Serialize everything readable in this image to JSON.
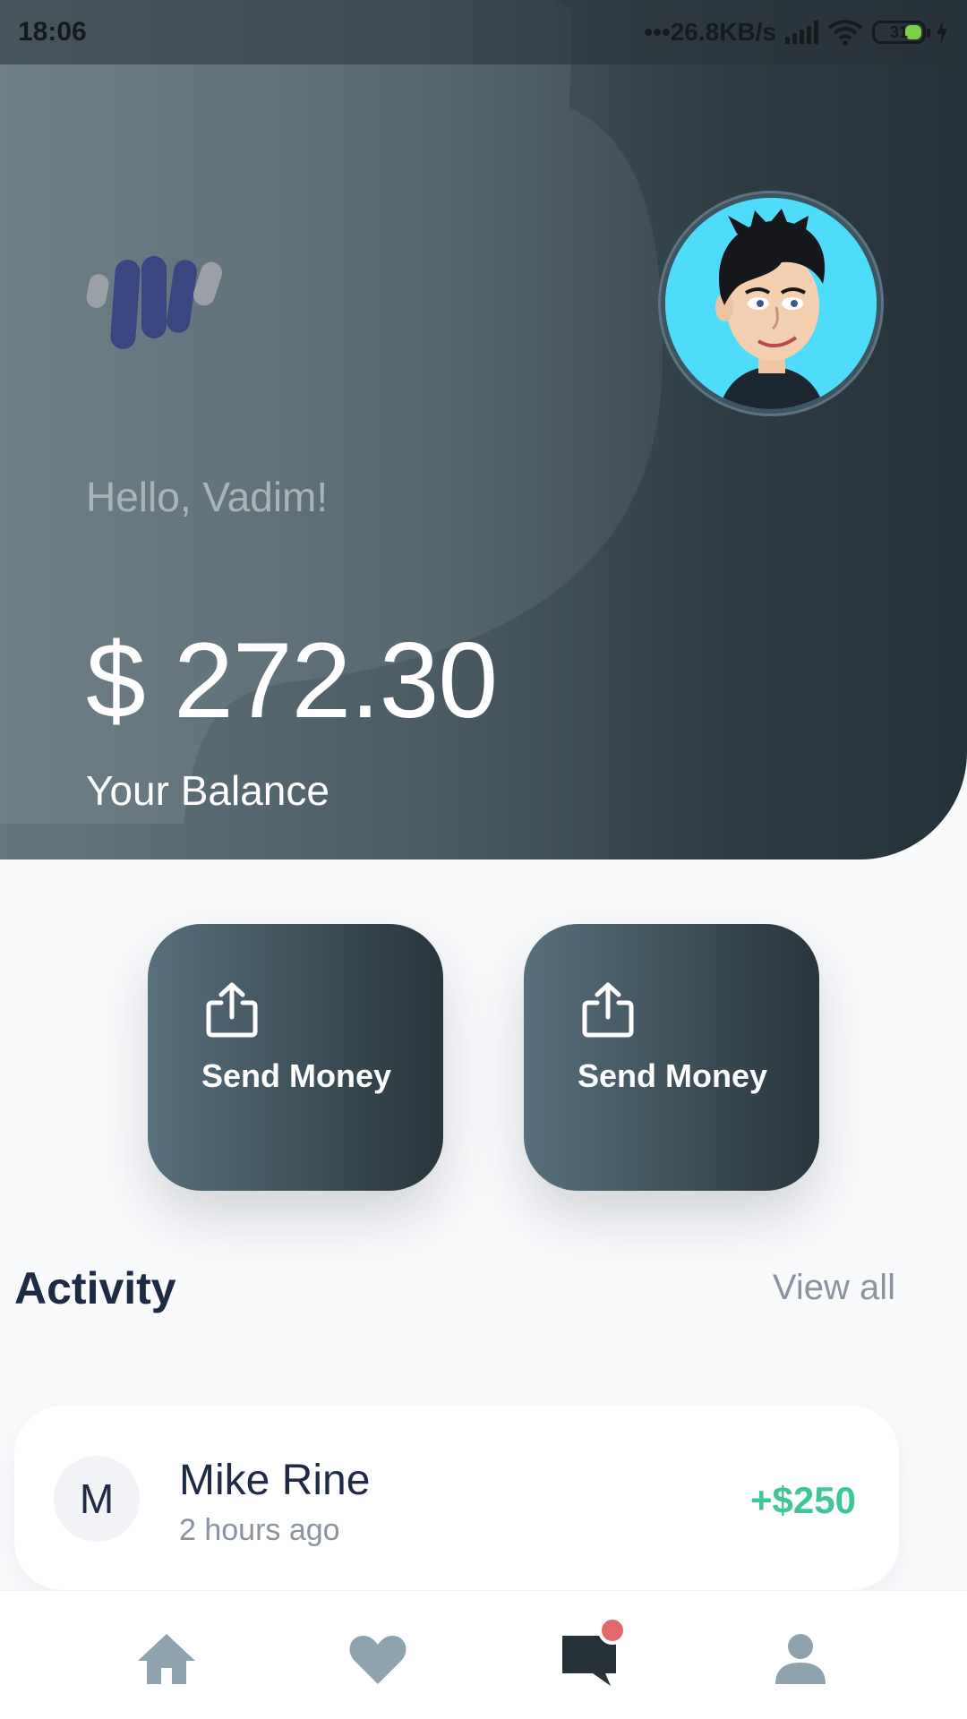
{
  "status_bar": {
    "time": "18:06",
    "network_speed": "26.8KB/s",
    "battery_level": "31"
  },
  "header": {
    "greeting": "Hello, Vadim!",
    "balance": "$ 272.30",
    "balance_label": "Your Balance"
  },
  "actions": [
    {
      "label": "Send Money",
      "icon": "share-upload-icon"
    },
    {
      "label": "Send Money",
      "icon": "share-upload-icon"
    }
  ],
  "activity": {
    "title": "Activity",
    "view_all": "View all",
    "items": [
      {
        "initial": "M",
        "name": "Mike Rine",
        "time": "2 hours ago",
        "amount": "+$250"
      }
    ]
  },
  "nav": {
    "items": [
      "home-icon",
      "heart-icon",
      "chat-icon",
      "profile-icon"
    ],
    "active_color": "#263238",
    "inactive_color": "#8ea3ad",
    "badge_color": "#e36a6a"
  },
  "colors": {
    "accent_positive": "#3ec792",
    "text_primary": "#1f2a44",
    "text_secondary": "#8a94a0"
  }
}
